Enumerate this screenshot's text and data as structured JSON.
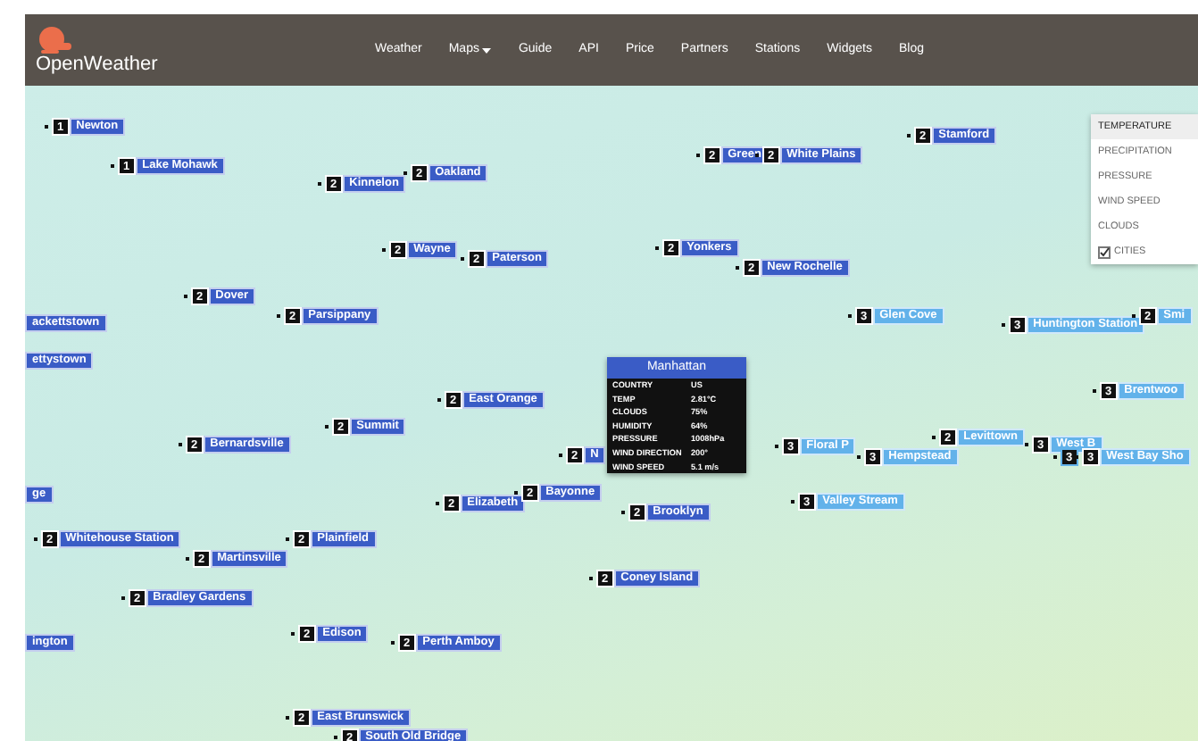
{
  "navbar": {
    "brand": "OpenWeather",
    "links": [
      {
        "label": "Weather",
        "dropdown": false
      },
      {
        "label": "Maps",
        "dropdown": true
      },
      {
        "label": "Guide",
        "dropdown": false
      },
      {
        "label": "API",
        "dropdown": false
      },
      {
        "label": "Price",
        "dropdown": false
      },
      {
        "label": "Partners",
        "dropdown": false
      },
      {
        "label": "Stations",
        "dropdown": false
      },
      {
        "label": "Widgets",
        "dropdown": false
      },
      {
        "label": "Blog",
        "dropdown": false
      }
    ]
  },
  "layers": [
    {
      "label": "TEMPERATURE",
      "selected": true
    },
    {
      "label": "PRECIPITATION",
      "selected": false
    },
    {
      "label": "PRESSURE",
      "selected": false
    },
    {
      "label": "WIND SPEED",
      "selected": false
    },
    {
      "label": "CLOUDS",
      "selected": false
    }
  ],
  "cities_toggle": {
    "label": "CITIES",
    "checked": true
  },
  "markers": [
    {
      "count": "1",
      "name": "Newton",
      "color": "#3a5cc6"
    },
    {
      "count": "1",
      "name": "Lake Mohawk",
      "color": "#3a5cc6"
    },
    {
      "count": "2",
      "name": "Kinnelon",
      "color": "#3a5cc6"
    },
    {
      "count": "2",
      "name": "Oakland",
      "color": "#3a5cc6"
    },
    {
      "count": "2",
      "name": "Wayne",
      "color": "#3a5cc6"
    },
    {
      "count": "2",
      "name": "Paterson",
      "color": "#3a5cc6"
    },
    {
      "count": "2",
      "name": "Dover",
      "color": "#3a5cc6"
    },
    {
      "count": "2",
      "name": "Parsippany",
      "color": "#3a5cc6"
    },
    {
      "name": "ackettstown",
      "color": "#3a5cc6"
    },
    {
      "name": "ettystown",
      "color": "#3a5cc6"
    },
    {
      "count": "2",
      "name": "East Orange",
      "color": "#3a5cc6"
    },
    {
      "count": "2",
      "name": "Green",
      "color": "#3a5cc6"
    },
    {
      "count": "2",
      "name": "White Plains",
      "color": "#3a5cc6"
    },
    {
      "count": "2",
      "name": "Stamford",
      "color": "#3a5cc6"
    },
    {
      "count": "2",
      "name": "Yonkers",
      "color": "#3a5cc6"
    },
    {
      "count": "2",
      "name": "New Rochelle",
      "color": "#3a5cc6"
    },
    {
      "count": "3",
      "name": "Glen Cove",
      "color": "#62b2ea"
    },
    {
      "count": "3",
      "name": "Huntington Station",
      "color": "#62b2ea"
    },
    {
      "count": "2",
      "name": "Smi",
      "color": "#62b2ea"
    },
    {
      "count": "3",
      "name": "Brentwoo",
      "color": "#62b2ea"
    },
    {
      "count": "2",
      "name": "N",
      "color": "#3a5cc6"
    },
    {
      "count": "2",
      "name": "Summit",
      "color": "#3a5cc6"
    },
    {
      "count": "2",
      "name": "Bernardsville",
      "color": "#3a5cc6"
    },
    {
      "name": "ge",
      "color": "#3a5cc6"
    },
    {
      "count": "2",
      "name": "Elizabeth",
      "color": "#3a5cc6"
    },
    {
      "count": "2",
      "name": "Bayonne",
      "color": "#3a5cc6"
    },
    {
      "count": "2",
      "name": "Brooklyn",
      "color": "#3a5cc6"
    },
    {
      "count": "3",
      "name": "Floral P",
      "color": "#62b2ea"
    },
    {
      "count": "3",
      "name": "Hempstead",
      "color": "#62b2ea"
    },
    {
      "count": "2",
      "name": "Levittown",
      "color": "#62b2ea"
    },
    {
      "count": "3",
      "name": "West B",
      "color": "#62b2ea"
    },
    {
      "count": "3",
      "color": "#62b2ea"
    },
    {
      "count": "3",
      "name": "West Bay Sho",
      "color": "#62b2ea"
    },
    {
      "count": "3",
      "name": "Valley Stream",
      "color": "#62b2ea"
    },
    {
      "count": "2",
      "name": "Whitehouse Station",
      "color": "#3a5cc6"
    },
    {
      "count": "2",
      "name": "Plainfield",
      "color": "#3a5cc6"
    },
    {
      "count": "2",
      "name": "Martinsville",
      "color": "#3a5cc6"
    },
    {
      "count": "2",
      "name": "Bradley Gardens",
      "color": "#3a5cc6"
    },
    {
      "count": "2",
      "name": "Coney Island",
      "color": "#3a5cc6"
    },
    {
      "name": "ington",
      "color": "#3a5cc6"
    },
    {
      "count": "2",
      "name": "Edison",
      "color": "#3a5cc6"
    },
    {
      "count": "2",
      "name": "Perth Amboy",
      "color": "#3a5cc6"
    },
    {
      "count": "2",
      "name": "East Brunswick",
      "color": "#3a5cc6"
    },
    {
      "count": "2",
      "name": "South Old Bridge",
      "color": "#3a5cc6"
    }
  ],
  "popup": {
    "title": "Manhattan",
    "rows": [
      {
        "label": "COUNTRY",
        "value": "US"
      },
      {
        "label": "TEMP",
        "value": "2.81°C"
      },
      {
        "label": "CLOUDS",
        "value": "75%"
      },
      {
        "label": "HUMIDITY",
        "value": "64%"
      },
      {
        "label": "PRESSURE",
        "value": "1008hPa"
      },
      {
        "label": "WIND DIRECTION",
        "value": "200°"
      },
      {
        "label": "WIND SPEED",
        "value": "5.1 m/s"
      }
    ]
  }
}
